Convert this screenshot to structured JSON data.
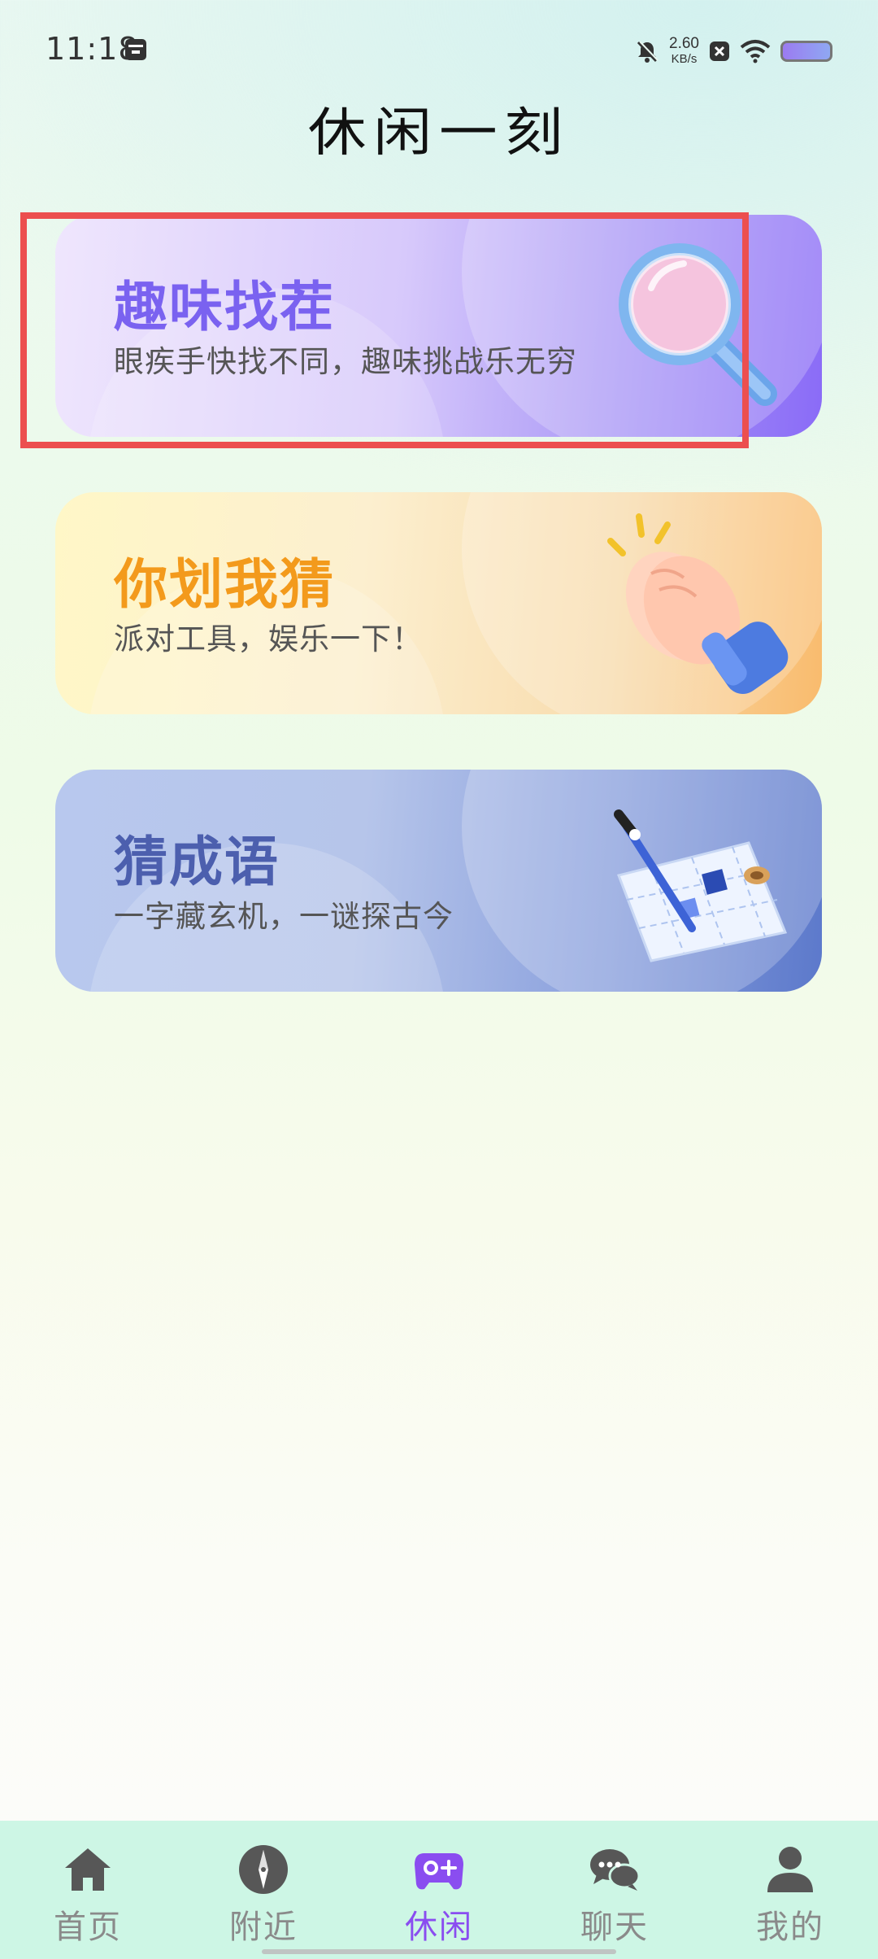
{
  "status_bar": {
    "time": "11:18",
    "net_speed_value": "2.60",
    "net_speed_unit": "KB/s",
    "icons": [
      "calendar-icon",
      "mute-bell-icon",
      "close-box-icon",
      "wifi-icon",
      "battery-icon"
    ],
    "battery_color": "#9b7bf1"
  },
  "page": {
    "title": "休闲一刻"
  },
  "cards": [
    {
      "title": "趣味找茬",
      "subtitle": "眼疾手快找不同，趣味挑战乐无穷",
      "icon": "magnifier-icon",
      "title_color": "#7a62f0"
    },
    {
      "title": "你划我猜",
      "subtitle": "派对工具，娱乐一下！",
      "icon": "clapping-hands-icon",
      "title_color": "#f39a1c"
    },
    {
      "title": "猜成语",
      "subtitle": "一字藏玄机，一谜探古今",
      "icon": "map-icon",
      "title_color": "#4c5fae"
    }
  ],
  "nav": {
    "items": [
      {
        "label": "首页",
        "icon": "home-icon"
      },
      {
        "label": "附近",
        "icon": "compass-icon"
      },
      {
        "label": "休闲",
        "icon": "gamepad-icon",
        "active": true
      },
      {
        "label": "聊天",
        "icon": "chat-bubbles-icon"
      },
      {
        "label": "我的",
        "icon": "user-icon"
      }
    ],
    "active_color": "#8a4df0",
    "inactive_color": "#8a8a8a"
  }
}
